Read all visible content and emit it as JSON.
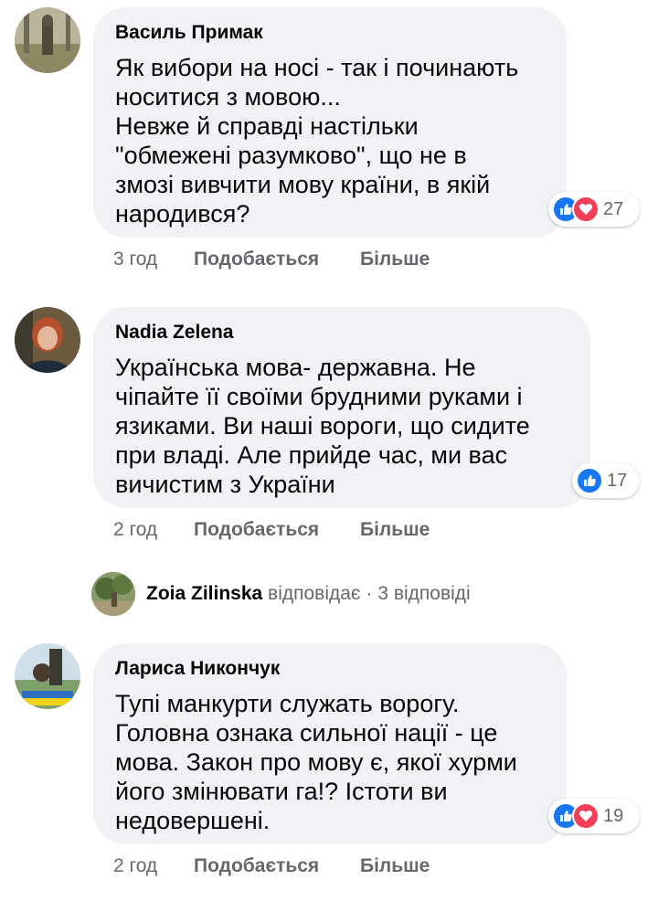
{
  "comments": [
    {
      "author": "Василь Примак",
      "text": "Як вибори на носі - так і починають\nноситися з мовою...\nНевже й справді настільки\n\"обмежені разумково\", що не в\nзмозі вивчити мову країни, в якій\nнародився?",
      "time": "3 год",
      "like_label": "Подобається",
      "more_label": "Більше",
      "reactions": [
        "like",
        "love"
      ],
      "reaction_count": "27"
    },
    {
      "author": "Nadia Zelena",
      "text": "Українська мова- державна. Не\nчіпайте її своїми брудними руками і\nязиками. Ви наші вороги, що сидите\nпри владі. Але прийде час, ми вас\nвичистим з України",
      "time": "2 год",
      "like_label": "Подобається",
      "more_label": "Більше",
      "reactions": [
        "like"
      ],
      "reaction_count": "17"
    },
    {
      "author": "Лариса Никончук",
      "text": "Тупі манкурти служать ворогу.\nГоловна ознака сильної нації - це\nмова. Закон про мову є, якої хурми\nйого змінювати га!? Істоти ви\nнедовершені.",
      "time": "2 год",
      "like_label": "Подобається",
      "more_label": "Більше",
      "reactions": [
        "like",
        "love"
      ],
      "reaction_count": "19"
    }
  ],
  "reply_summary": {
    "author": "Zoia Zilinska",
    "action": "відповідає",
    "separator": "·",
    "count_label": "3 відповіді"
  },
  "colors": {
    "bubble_bg": "#f0f2f5",
    "meta_text": "#65676b",
    "like_blue": "#1877f2",
    "love_red": "#f33e58"
  }
}
